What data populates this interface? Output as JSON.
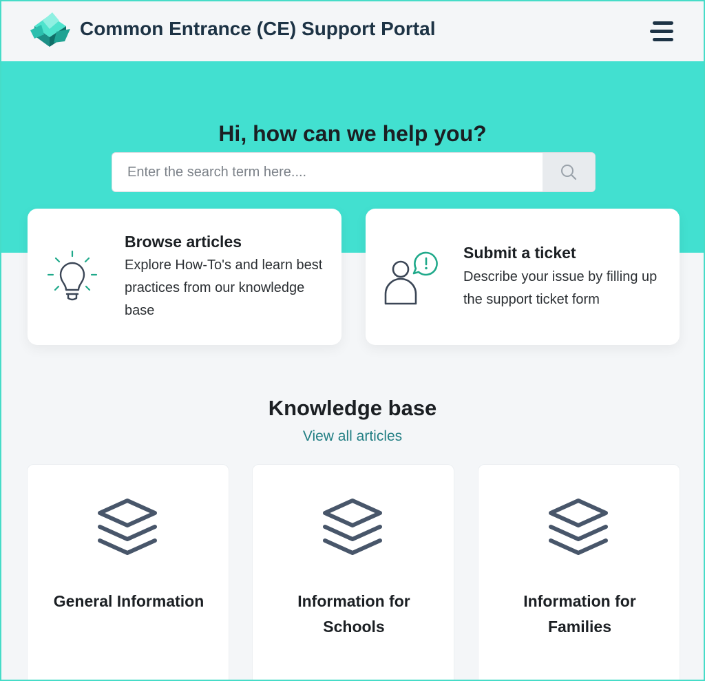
{
  "header": {
    "title": "Common Entrance (CE) Support Portal",
    "logo_icon": "portal-logo",
    "menu_icon": "hamburger-menu-icon"
  },
  "hero": {
    "title": "Hi, how can we help you?",
    "search_placeholder": "Enter the search term here....",
    "search_icon": "search-icon"
  },
  "actions": [
    {
      "title": "Browse articles",
      "description": "Explore How-To's and learn best practices from our knowledge base",
      "icon": "lightbulb-icon"
    },
    {
      "title": "Submit a ticket",
      "description": "Describe your issue by filling up the support ticket form",
      "icon": "user-alert-icon"
    }
  ],
  "knowledge_base": {
    "title": "Knowledge base",
    "view_all": "View all articles",
    "categories": [
      {
        "label": "General Information",
        "icon": "layers-icon"
      },
      {
        "label": "Information for Schools",
        "icon": "layers-icon"
      },
      {
        "label": "Information for Families",
        "icon": "layers-icon"
      }
    ]
  },
  "colors": {
    "accent": "#42e0d0",
    "heading": "#1d3345",
    "link": "#227f84",
    "icon_green": "#1fa98a",
    "icon_slate": "#48566a"
  }
}
